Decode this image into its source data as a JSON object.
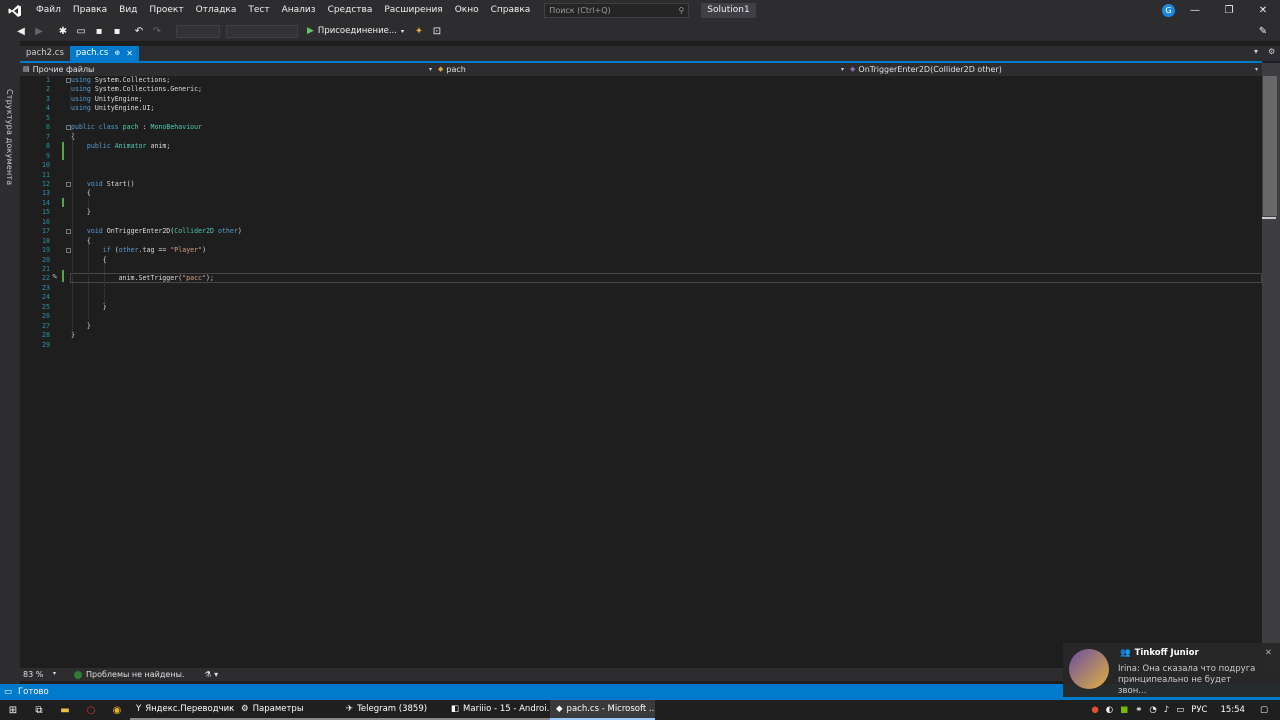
{
  "menu": {
    "items": [
      "Файл",
      "Правка",
      "Вид",
      "Проект",
      "Отладка",
      "Тест",
      "Анализ",
      "Средства",
      "Расширения",
      "Окно",
      "Справка"
    ],
    "search_placeholder": "Поиск (Ctrl+Q)",
    "solution": "Solution1",
    "account_initial": "G"
  },
  "toolbar": {
    "attach_label": "Присоединение..."
  },
  "sidebar": {
    "label": "Структура документа"
  },
  "tabs": [
    {
      "label": "pach2.cs",
      "active": false
    },
    {
      "label": "pach.cs",
      "active": true,
      "pin": "⊕",
      "close": "✕"
    }
  ],
  "navbar": {
    "project": "Прочие файлы",
    "class": "pach",
    "member": "OnTriggerEnter2D(Collider2D other)"
  },
  "code_lines": [
    {
      "n": "1",
      "html": "<span class='kw'>using</span> <span class='txt'>System.Collections;</span>"
    },
    {
      "n": "2",
      "html": "<span class='kw'>using</span> <span class='txt'>System.Collections.Generic;</span>"
    },
    {
      "n": "3",
      "html": "<span class='kw'>using</span> <span class='txt'>UnityEngine;</span>"
    },
    {
      "n": "4",
      "html": "<span class='kw'>using</span> <span class='txt'>UnityEngine.UI;</span>"
    },
    {
      "n": "5",
      "html": ""
    },
    {
      "n": "6",
      "html": "<span class='kw'>public class</span> <span class='ty'>pach</span> <span class='txt'>:</span> <span class='ty'>MonoBehaviour</span>"
    },
    {
      "n": "7",
      "html": "<span class='txt'>{</span>"
    },
    {
      "n": "8",
      "html": "    <span class='kw'>public</span> <span class='ty'>Animator</span> <span class='txt'>anim;</span>"
    },
    {
      "n": "9",
      "html": ""
    },
    {
      "n": "10",
      "html": ""
    },
    {
      "n": "11",
      "html": ""
    },
    {
      "n": "12",
      "html": "    <span class='kw'>void</span> <span class='txt'>Start()</span>"
    },
    {
      "n": "13",
      "html": "    <span class='txt'>{</span>"
    },
    {
      "n": "14",
      "html": ""
    },
    {
      "n": "15",
      "html": "    <span class='txt'>}</span>"
    },
    {
      "n": "16",
      "html": ""
    },
    {
      "n": "17",
      "html": "    <span class='kw'>void</span> <span class='txt'>OnTriggerEnter2D(</span><span class='ty'>Collider2D</span> <span class='kw'>other</span><span class='txt'>)</span>"
    },
    {
      "n": "18",
      "html": "    <span class='txt'>{</span>"
    },
    {
      "n": "19",
      "html": "        <span class='kw'>if</span> <span class='txt'>(</span><span class='kw'>other</span><span class='txt'>.tag ==</span> <span class='str'>\"Player\"</span><span class='txt'>)</span>"
    },
    {
      "n": "20",
      "html": "        <span class='txt'>{</span>"
    },
    {
      "n": "21",
      "html": ""
    },
    {
      "n": "22",
      "html": "            <span class='txt'>anim.SetTrigger(</span><span class='str'>\"pacc\"</span><span class='txt'>);</span>"
    },
    {
      "n": "23",
      "html": ""
    },
    {
      "n": "24",
      "html": ""
    },
    {
      "n": "25",
      "html": "        <span class='txt'>}</span>"
    },
    {
      "n": "26",
      "html": ""
    },
    {
      "n": "27",
      "html": "    <span class='txt'>}</span>"
    },
    {
      "n": "28",
      "html": "<span class='txt'>}</span>"
    },
    {
      "n": "29",
      "html": ""
    }
  ],
  "editor_status": {
    "zoom": "83 %",
    "issues": "Проблемы не найдены."
  },
  "statusbar": {
    "text": "Готово"
  },
  "taskbar": {
    "apps": [
      {
        "label": "Яндекс.Переводчик ...",
        "icon": "Y",
        "active": false
      },
      {
        "label": "Параметры",
        "icon": "⚙",
        "active": false
      },
      {
        "label": "Telegram (3859)",
        "icon": "✈",
        "active": false
      },
      {
        "label": "Mariiio - 15 - Androi...",
        "icon": "◧",
        "active": false
      },
      {
        "label": "pach.cs - Microsoft ...",
        "icon": "◆",
        "active": true
      }
    ],
    "lang": "РУС",
    "time": "15:54"
  },
  "toast": {
    "app": "Tinkoff Junior",
    "message": "Irina: Она сказала что подруга принципеально не будет звон..."
  }
}
